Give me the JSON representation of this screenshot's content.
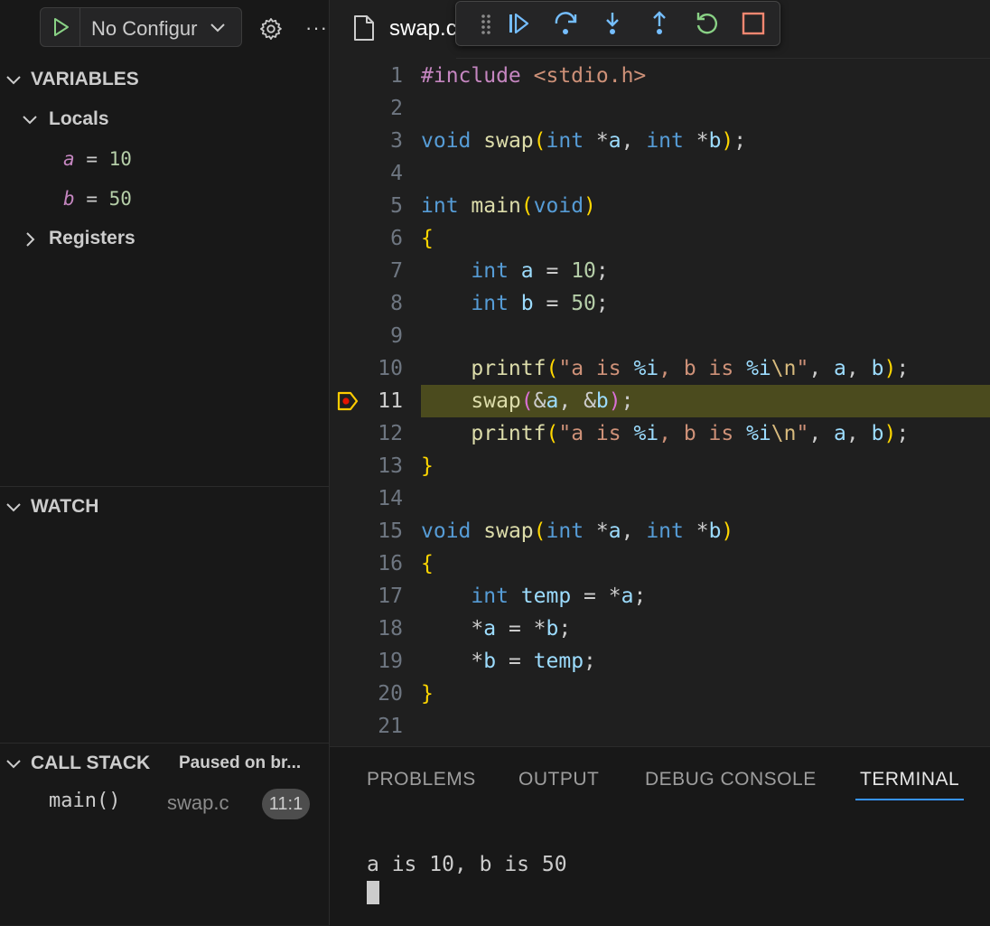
{
  "run": {
    "config_label": "No Configur"
  },
  "sidebar": {
    "variables": {
      "title": "VARIABLES",
      "locals_label": "Locals",
      "locals": [
        {
          "name": "a",
          "eq": "=",
          "value": "10"
        },
        {
          "name": "b",
          "eq": "=",
          "value": "50"
        }
      ],
      "registers_label": "Registers"
    },
    "watch": {
      "title": "WATCH"
    },
    "call_stack": {
      "title": "CALL STACK",
      "status": "Paused on br...",
      "frames": [
        {
          "name": "main()",
          "file": "swap.c",
          "position": "11:1"
        }
      ]
    },
    "more_label": "···"
  },
  "editor": {
    "tab": {
      "name": "swap.c"
    },
    "current_line": 11,
    "lines": [
      {
        "n": "1"
      },
      {
        "n": "2"
      },
      {
        "n": "3"
      },
      {
        "n": "4"
      },
      {
        "n": "5"
      },
      {
        "n": "6"
      },
      {
        "n": "7"
      },
      {
        "n": "8"
      },
      {
        "n": "9"
      },
      {
        "n": "10"
      },
      {
        "n": "11"
      },
      {
        "n": "12"
      },
      {
        "n": "13"
      },
      {
        "n": "14"
      },
      {
        "n": "15"
      },
      {
        "n": "16"
      },
      {
        "n": "17"
      },
      {
        "n": "18"
      },
      {
        "n": "19"
      },
      {
        "n": "20"
      },
      {
        "n": "21"
      }
    ],
    "code": {
      "l1": [
        "#include",
        " ",
        "<stdio.h>"
      ],
      "l3": [
        "void",
        " ",
        "swap",
        "(",
        "int",
        " *",
        "a",
        ", ",
        "int",
        " *",
        "b",
        ")",
        ";"
      ],
      "l5": [
        "int",
        " ",
        "main",
        "(",
        "void",
        ")"
      ],
      "l6": [
        "{"
      ],
      "l7": [
        "    ",
        "int",
        " ",
        "a",
        " = ",
        "10",
        ";"
      ],
      "l8": [
        "    ",
        "int",
        " ",
        "b",
        " = ",
        "50",
        ";"
      ],
      "l10": [
        "    ",
        "printf",
        "(",
        "\"a is ",
        "%i",
        ", b is ",
        "%i",
        "\\n",
        "\"",
        ", ",
        "a",
        ", ",
        "b",
        ")",
        ";"
      ],
      "l11": [
        "    ",
        "swap",
        "(",
        "&",
        "a",
        ", ",
        "&",
        "b",
        ")",
        ";"
      ],
      "l12": [
        "    ",
        "printf",
        "(",
        "\"a is ",
        "%i",
        ", b is ",
        "%i",
        "\\n",
        "\"",
        ", ",
        "a",
        ", ",
        "b",
        ")",
        ";"
      ],
      "l13": [
        "}"
      ],
      "l15": [
        "void",
        " ",
        "swap",
        "(",
        "int",
        " *",
        "a",
        ", ",
        "int",
        " *",
        "b",
        ")"
      ],
      "l16": [
        "{"
      ],
      "l17": [
        "    ",
        "int",
        " ",
        "temp",
        " = *",
        "a",
        ";"
      ],
      "l18": [
        "    *",
        "a",
        " = *",
        "b",
        ";"
      ],
      "l19": [
        "    *",
        "b",
        " = ",
        "temp",
        ";"
      ],
      "l20": [
        "}"
      ]
    }
  },
  "debug_toolbar": {
    "buttons": [
      "grip",
      "continue",
      "step-over",
      "step-into",
      "step-out",
      "restart",
      "stop"
    ]
  },
  "panel": {
    "tabs": [
      "PROBLEMS",
      "OUTPUT",
      "DEBUG CONSOLE",
      "TERMINAL"
    ],
    "active_tab": "TERMINAL",
    "terminal_output": "a is 10, b is 50"
  },
  "colors": {
    "keyword": "#569cd6",
    "function": "#dcdcaa",
    "string": "#ce9178",
    "number": "#b5cea8",
    "variable": "#9cdcfe",
    "bracket": "#ffd700",
    "bracket_inner": "#da70d6",
    "current_line_bg": "#4b4b1e",
    "active_tab_underline": "#3794ff",
    "breakpoint": "#ffcc00"
  }
}
